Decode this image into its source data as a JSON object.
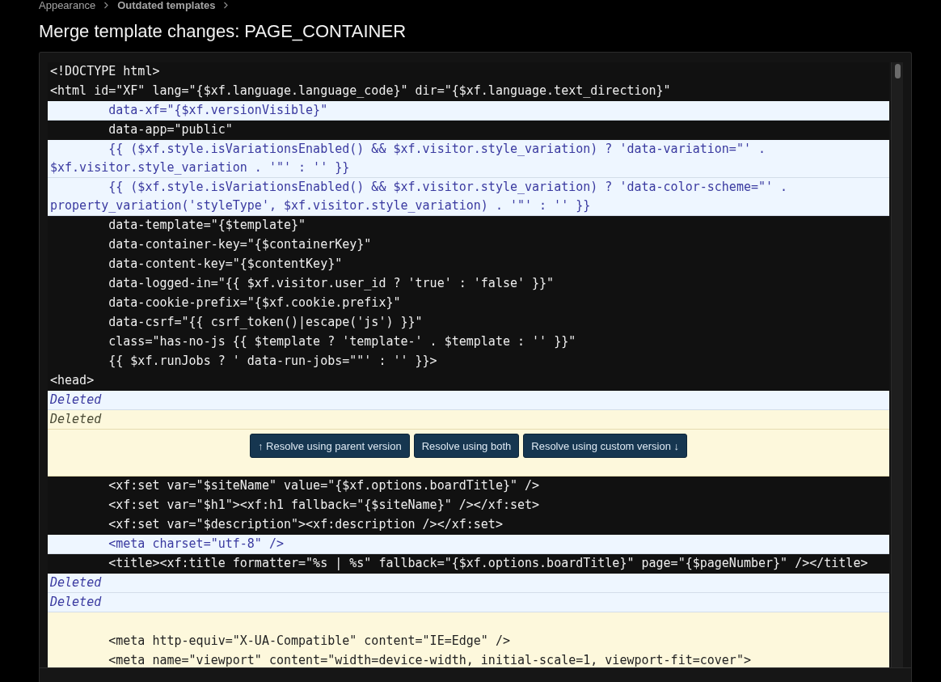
{
  "breadcrumb": [
    {
      "label": "Appearance",
      "current": false
    },
    {
      "label": "Outdated templates",
      "current": true
    }
  ],
  "title": "Merge template changes: PAGE_CONTAINER",
  "lines": [
    {
      "kind": "same",
      "text": "<!DOCTYPE html>"
    },
    {
      "kind": "same",
      "text": "<html id=\"XF\" lang=\"{$xf.language.language_code}\" dir=\"{$xf.language.text_direction}\""
    },
    {
      "kind": "added",
      "text": "        data-xf=\"{$xf.versionVisible}\""
    },
    {
      "kind": "same",
      "text": "        data-app=\"public\""
    },
    {
      "kind": "added",
      "text": "        {{ ($xf.style.isVariationsEnabled() && $xf.visitor.style_variation) ? 'data-variation=\"' . $xf.visitor.style_variation . '\"' : '' }}"
    },
    {
      "kind": "added",
      "text": "        {{ ($xf.style.isVariationsEnabled() && $xf.visitor.style_variation) ? 'data-color-scheme=\"' . property_variation('styleType', $xf.visitor.style_variation) . '\"' : '' }}"
    },
    {
      "kind": "same",
      "text": "        data-template=\"{$template}\""
    },
    {
      "kind": "same",
      "text": "        data-container-key=\"{$containerKey}\""
    },
    {
      "kind": "same",
      "text": "        data-content-key=\"{$contentKey}\""
    },
    {
      "kind": "same",
      "text": "        data-logged-in=\"{{ $xf.visitor.user_id ? 'true' : 'false' }}\""
    },
    {
      "kind": "same",
      "text": "        data-cookie-prefix=\"{$xf.cookie.prefix}\""
    },
    {
      "kind": "same",
      "text": "        data-csrf=\"{{ csrf_token()|escape('js') }}\""
    },
    {
      "kind": "same",
      "text": "        class=\"has-no-js {{ $template ? 'template-' . $template : '' }}\""
    },
    {
      "kind": "same",
      "text": "        {{ $xf.runJobs ? ' data-run-jobs=\"\"' : '' }}>"
    },
    {
      "kind": "same",
      "text": "<head>"
    },
    {
      "kind": "deleted",
      "text": "Deleted"
    },
    {
      "kind": "conflict_deleted",
      "text": "Deleted"
    },
    {
      "kind": "conflict_actions",
      "buttons": [
        "↑ Resolve using parent version",
        "Resolve using both",
        "Resolve using custom version ↓"
      ]
    },
    {
      "kind": "same",
      "text": "        <xf:set var=\"$siteName\" value=\"{$xf.options.boardTitle}\" />"
    },
    {
      "kind": "same",
      "text": "        <xf:set var=\"$h1\"><xf:h1 fallback=\"{$siteName}\" /></xf:set>"
    },
    {
      "kind": "same",
      "text": "        <xf:set var=\"$description\"><xf:description /></xf:set>"
    },
    {
      "kind": "added",
      "text": "        <meta charset=\"utf-8\" />"
    },
    {
      "kind": "same",
      "text": "        <title><xf:title formatter=\"%s | %s\" fallback=\"{$xf.options.boardTitle}\" page=\"{$pageNumber}\" /></title>"
    },
    {
      "kind": "deleted",
      "text": "Deleted"
    },
    {
      "kind": "deleted",
      "text": "Deleted"
    },
    {
      "kind": "conflict_blank"
    },
    {
      "kind": "conflict",
      "text": "        <meta http-equiv=\"X-UA-Compatible\" content=\"IE=Edge\" />"
    },
    {
      "kind": "conflict",
      "text": "        <meta name=\"viewport\" content=\"width=device-width, initial-scale=1, viewport-fit=cover\">"
    }
  ]
}
